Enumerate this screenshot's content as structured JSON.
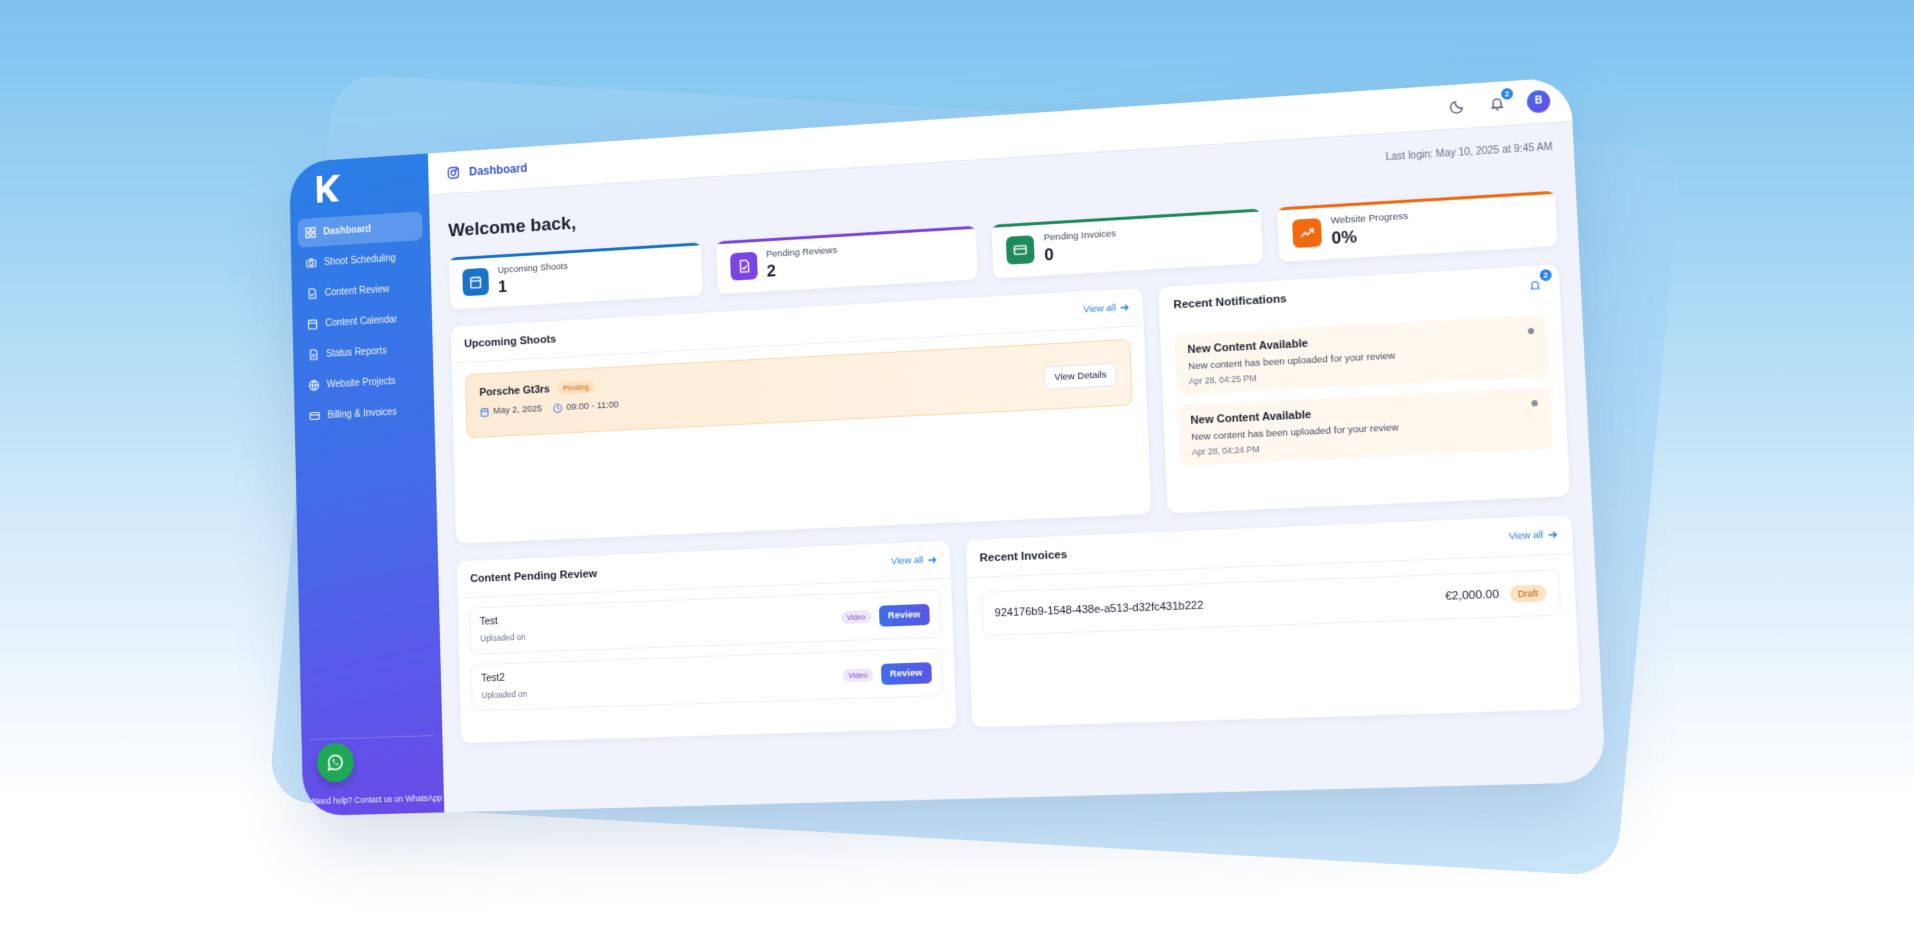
{
  "sidebar": {
    "items": [
      {
        "label": "Dashboard",
        "icon": "grid-icon",
        "active": true
      },
      {
        "label": "Shoot Scheduling",
        "icon": "camera-icon"
      },
      {
        "label": "Content Review",
        "icon": "file-check-icon"
      },
      {
        "label": "Content Calendar",
        "icon": "calendar-icon"
      },
      {
        "label": "Status Reports",
        "icon": "file-text-icon"
      },
      {
        "label": "Website Projects",
        "icon": "globe-icon"
      },
      {
        "label": "Billing & Invoices",
        "icon": "credit-card-icon"
      }
    ],
    "help_text": "Need help? Contact us on WhatsApp"
  },
  "topbar": {
    "breadcrumb": "Dashboard",
    "notification_count": "2",
    "avatar_initial": "B"
  },
  "welcome": {
    "title": "Welcome back,",
    "last_login": "Last login: May 10, 2025 at 9:45 AM"
  },
  "stats": [
    {
      "label": "Upcoming Shoots",
      "value": "1",
      "color": "#1a73c9"
    },
    {
      "label": "Pending Reviews",
      "value": "2",
      "color": "#7b46e0"
    },
    {
      "label": "Pending Invoices",
      "value": "0",
      "color": "#1f8a5a"
    },
    {
      "label": "Website Progress",
      "value": "0%",
      "color": "#f26a10"
    }
  ],
  "upcoming_shoots": {
    "title": "Upcoming Shoots",
    "view_all": "View all",
    "items": [
      {
        "name": "Porsche Gt3rs",
        "status": "Pending",
        "date": "May 2, 2025",
        "time": "09:00 - 11:00",
        "action": "View Details"
      }
    ]
  },
  "notifications": {
    "title": "Recent Notifications",
    "count": "2",
    "items": [
      {
        "title": "New Content Available",
        "body": "New content has been uploaded for your review",
        "time": "Apr 28, 04:25 PM"
      },
      {
        "title": "New Content Available",
        "body": "New content has been uploaded for your review",
        "time": "Apr 28, 04:24 PM"
      }
    ]
  },
  "pending_review": {
    "title": "Content Pending Review",
    "view_all": "View all",
    "items": [
      {
        "title": "Test",
        "subtitle": "Uploaded on",
        "type": "Video",
        "action": "Review"
      },
      {
        "title": "Test2",
        "subtitle": "Uploaded on",
        "type": "Video",
        "action": "Review"
      }
    ]
  },
  "invoices": {
    "title": "Recent Invoices",
    "view_all": "View all",
    "items": [
      {
        "id": "924176b9-1548-438e-a513-d32fc431b222",
        "amount": "€2,000.00",
        "status": "Draft"
      }
    ]
  }
}
